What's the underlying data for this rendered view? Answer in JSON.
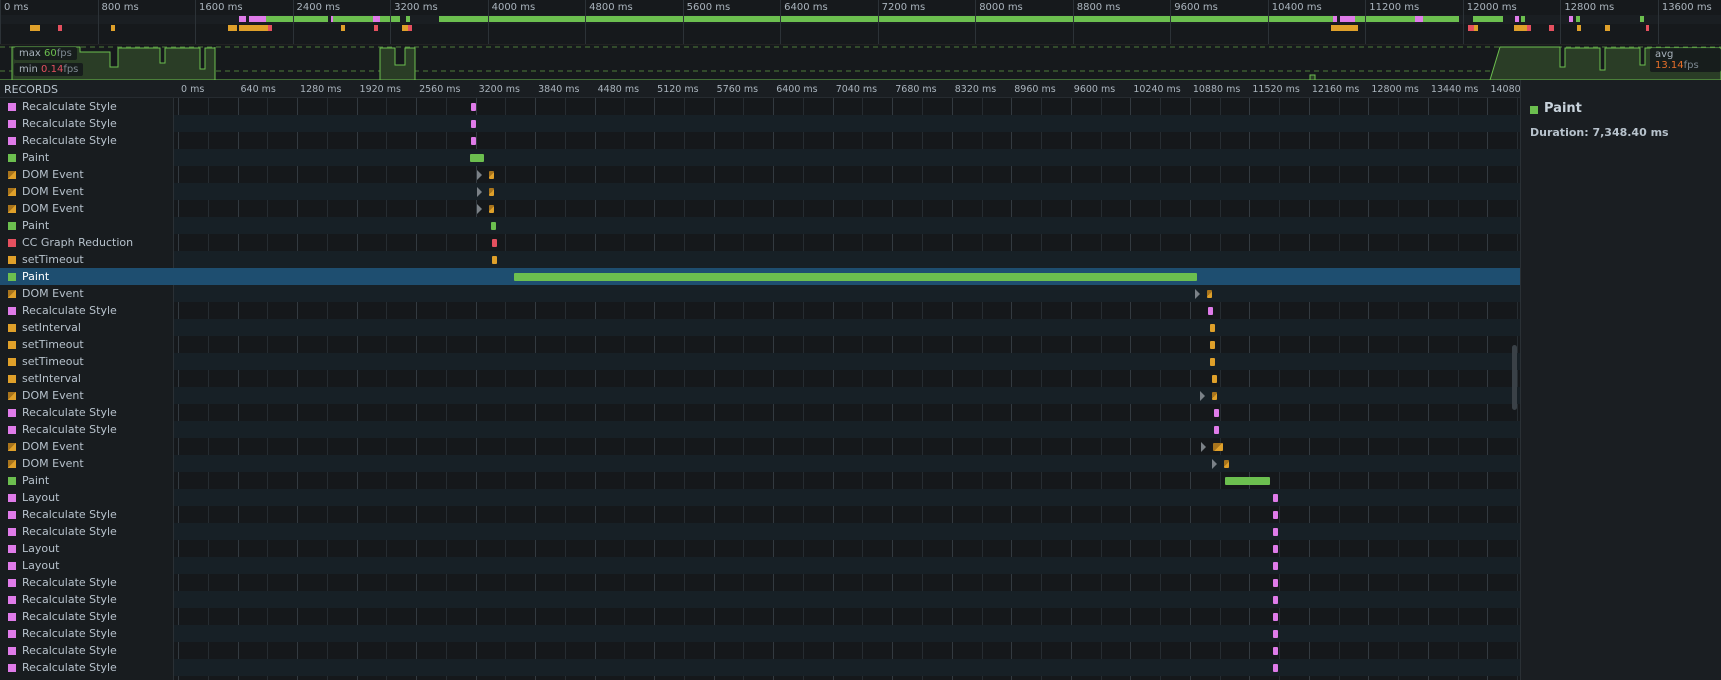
{
  "colors": {
    "rendering": "#df7be9",
    "painting": "#6cbf4f",
    "scripting": "#dfa02a",
    "other": "#e5505f",
    "selected": "#1e4e70"
  },
  "overview": {
    "ticks": [
      "0 ms",
      "800 ms",
      "1600 ms",
      "2400 ms",
      "3200 ms",
      "4000 ms",
      "4800 ms",
      "5600 ms",
      "6400 ms",
      "7200 ms",
      "8000 ms",
      "8800 ms",
      "9600 ms",
      "10400 ms",
      "11200 ms",
      "12000 ms",
      "12800 ms",
      "13600 ms"
    ],
    "row1": [
      [
        1960,
        2015,
        "rendering"
      ],
      [
        2040,
        2180,
        "rendering"
      ],
      [
        2180,
        2690,
        "painting"
      ],
      [
        2715,
        2740,
        "rendering"
      ],
      [
        2735,
        3060,
        "painting"
      ],
      [
        3060,
        3120,
        "rendering"
      ],
      [
        3120,
        3285,
        "painting"
      ],
      [
        3330,
        3360,
        "painting"
      ],
      [
        3600,
        10935,
        "painting"
      ],
      [
        10935,
        10970,
        "rendering"
      ],
      [
        10990,
        11115,
        "rendering"
      ],
      [
        11115,
        11610,
        "painting"
      ],
      [
        11610,
        11670,
        "rendering"
      ],
      [
        11670,
        11970,
        "painting"
      ],
      [
        12085,
        12330,
        "painting"
      ],
      [
        12430,
        12465,
        "rendering"
      ],
      [
        12480,
        12510,
        "painting"
      ],
      [
        12870,
        12900,
        "rendering"
      ],
      [
        12925,
        12960,
        "painting"
      ],
      [
        13455,
        13490,
        "painting"
      ]
    ],
    "row2": [
      [
        250,
        325,
        "scripting"
      ],
      [
        475,
        510,
        "other"
      ],
      [
        910,
        945,
        "scripting"
      ],
      [
        1870,
        1945,
        "scripting"
      ],
      [
        1960,
        2195,
        "scripting"
      ],
      [
        2195,
        2230,
        "other"
      ],
      [
        2795,
        2830,
        "scripting"
      ],
      [
        3070,
        3105,
        "other"
      ],
      [
        3295,
        3350,
        "scripting"
      ],
      [
        3350,
        3380,
        "other"
      ],
      [
        10915,
        11140,
        "scripting"
      ],
      [
        12040,
        12095,
        "other"
      ],
      [
        12095,
        12125,
        "scripting"
      ],
      [
        12420,
        12530,
        "scripting"
      ],
      [
        12530,
        12560,
        "other"
      ],
      [
        12710,
        12745,
        "other"
      ],
      [
        12935,
        12970,
        "scripting"
      ],
      [
        13165,
        13210,
        "scripting"
      ],
      [
        13500,
        13530,
        "other"
      ]
    ]
  },
  "fps": {
    "max_label": "max",
    "max_value": "60",
    "min_label": "min",
    "min_value": "0.14",
    "avg_label": "avg",
    "avg_value": "13.14",
    "unit": "fps"
  },
  "records_title": "RECORDS",
  "timeline_ticks": [
    "0 ms",
    "640 ms",
    "1280 ms",
    "1920 ms",
    "2560 ms",
    "3200 ms",
    "3840 ms",
    "4480 ms",
    "5120 ms",
    "5760 ms",
    "6400 ms",
    "7040 ms",
    "7680 ms",
    "8320 ms",
    "8960 ms",
    "9600 ms",
    "10240 ms",
    "10880 ms",
    "11520 ms",
    "12160 ms",
    "12800 ms",
    "13440 ms",
    "14080 ms"
  ],
  "records": [
    {
      "name": "Recalculate Style",
      "cat": "rendering",
      "start": 3150,
      "dur": 40
    },
    {
      "name": "Recalculate Style",
      "cat": "rendering",
      "start": 3150,
      "dur": 40
    },
    {
      "name": "Recalculate Style",
      "cat": "rendering",
      "start": 3150,
      "dur": 40
    },
    {
      "name": "Paint",
      "cat": "painting",
      "start": 3140,
      "dur": 154
    },
    {
      "name": "DOM Event",
      "cat": "scripting",
      "event": true,
      "start": 3340,
      "dur": 40
    },
    {
      "name": "DOM Event",
      "cat": "scripting",
      "event": true,
      "start": 3340,
      "dur": 40
    },
    {
      "name": "DOM Event",
      "cat": "scripting",
      "event": true,
      "start": 3340,
      "dur": 40
    },
    {
      "name": "Paint",
      "cat": "painting",
      "start": 3365,
      "dur": 40
    },
    {
      "name": "CC Graph Reduction",
      "cat": "other",
      "start": 3377,
      "dur": 40
    },
    {
      "name": "setTimeout",
      "cat": "scripting",
      "start": 3377,
      "dur": 40
    },
    {
      "name": "Paint",
      "cat": "painting",
      "start": 3614,
      "dur": 7348.4,
      "selected": true
    },
    {
      "name": "DOM Event",
      "cat": "scripting",
      "event": true,
      "start": 11068,
      "dur": 40
    },
    {
      "name": "Recalculate Style",
      "cat": "rendering",
      "start": 11080,
      "dur": 40
    },
    {
      "name": "setInterval",
      "cat": "scripting",
      "start": 11092,
      "dur": 40
    },
    {
      "name": "setTimeout",
      "cat": "scripting",
      "start": 11092,
      "dur": 40
    },
    {
      "name": "setTimeout",
      "cat": "scripting",
      "start": 11092,
      "dur": 40
    },
    {
      "name": "setInterval",
      "cat": "scripting",
      "start": 11115,
      "dur": 40
    },
    {
      "name": "DOM Event",
      "cat": "scripting",
      "event": true,
      "start": 11115,
      "dur": 40
    },
    {
      "name": "Recalculate Style",
      "cat": "rendering",
      "start": 11139,
      "dur": 40
    },
    {
      "name": "Recalculate Style",
      "cat": "rendering",
      "start": 11139,
      "dur": 40
    },
    {
      "name": "DOM Event",
      "cat": "scripting",
      "event": true,
      "start": 11127,
      "dur": 107
    },
    {
      "name": "DOM Event",
      "cat": "scripting",
      "event": true,
      "start": 11246,
      "dur": 40
    },
    {
      "name": "Paint",
      "cat": "painting",
      "start": 11258,
      "dur": 486
    },
    {
      "name": "Layout",
      "cat": "rendering",
      "start": 11779,
      "dur": 40
    },
    {
      "name": "Recalculate Style",
      "cat": "rendering",
      "start": 11779,
      "dur": 40
    },
    {
      "name": "Recalculate Style",
      "cat": "rendering",
      "start": 11779,
      "dur": 40
    },
    {
      "name": "Layout",
      "cat": "rendering",
      "start": 11779,
      "dur": 40
    },
    {
      "name": "Layout",
      "cat": "rendering",
      "start": 11779,
      "dur": 40
    },
    {
      "name": "Recalculate Style",
      "cat": "rendering",
      "start": 11779,
      "dur": 40
    },
    {
      "name": "Recalculate Style",
      "cat": "rendering",
      "start": 11779,
      "dur": 40
    },
    {
      "name": "Recalculate Style",
      "cat": "rendering",
      "start": 11779,
      "dur": 40
    },
    {
      "name": "Recalculate Style",
      "cat": "rendering",
      "start": 11779,
      "dur": 40
    },
    {
      "name": "Recalculate Style",
      "cat": "rendering",
      "start": 11779,
      "dur": 40
    },
    {
      "name": "Recalculate Style",
      "cat": "rendering",
      "start": 11779,
      "dur": 40
    }
  ],
  "details": {
    "title": "Paint",
    "category": "painting",
    "duration": "Duration: 7,348.40 ms"
  }
}
